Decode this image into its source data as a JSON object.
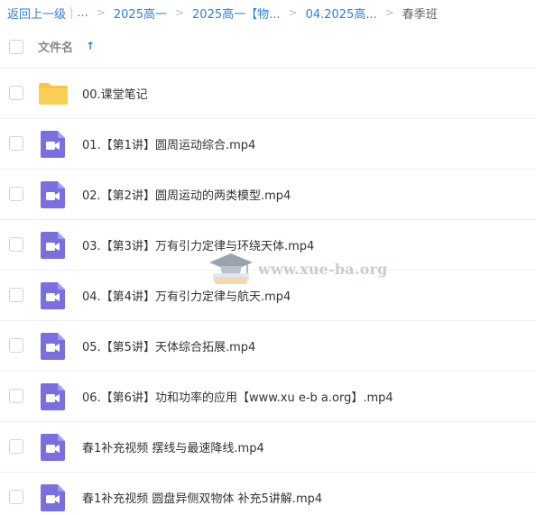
{
  "breadcrumb": {
    "back": "返回上一级",
    "ellipsis": "...",
    "items": [
      "2025高一",
      "2025高一【物...",
      "04.2025高...",
      "春季班"
    ]
  },
  "header": {
    "column_name": "文件名",
    "sort_icon": "arrow-up-icon"
  },
  "files": [
    {
      "name": "00.课堂笔记",
      "type": "folder",
      "icon": "folder-icon"
    },
    {
      "name": "01.【第1讲】圆周运动综合.mp4",
      "type": "video",
      "icon": "video-file-icon"
    },
    {
      "name": "02.【第2讲】圆周运动的两类模型.mp4",
      "type": "video",
      "icon": "video-file-icon"
    },
    {
      "name": "03.【第3讲】万有引力定律与环绕天体.mp4",
      "type": "video",
      "icon": "video-file-icon"
    },
    {
      "name": "04.【第4讲】万有引力定律与航天.mp4",
      "type": "video",
      "icon": "video-file-icon"
    },
    {
      "name": "05.【第5讲】天体综合拓展.mp4",
      "type": "video",
      "icon": "video-file-icon"
    },
    {
      "name": "06.【第6讲】功和功率的应用【www.xu e-b a.org】.mp4",
      "type": "video",
      "icon": "video-file-icon"
    },
    {
      "name": "春1补充视频 摆线与最速降线.mp4",
      "type": "video",
      "icon": "video-file-icon"
    },
    {
      "name": "春1补充视频 圆盘异侧双物体 补充5讲解.mp4",
      "type": "video",
      "icon": "video-file-icon"
    }
  ],
  "watermark": {
    "text": "www.xue-ba.org"
  },
  "colors": {
    "link": "#2f7fd6",
    "folder": "#f8c63f",
    "video": "#7b6fe0",
    "divider": "#eef0f4"
  }
}
